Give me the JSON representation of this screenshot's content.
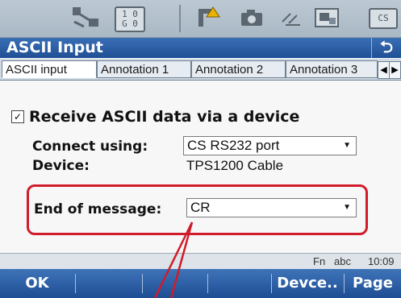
{
  "statusbar": {
    "icons": [
      "satellite-icon",
      "radio-icon",
      "level-icon",
      "camera-icon",
      "pen-icon",
      "image-icon",
      "memory-icon"
    ],
    "radio_top": "1 0",
    "radio_bottom": "G 0",
    "memory_label": "CS"
  },
  "title": "ASCII Input",
  "tabs": [
    "ASCII input",
    "Annotation 1",
    "Annotation 2",
    "Annotation 3"
  ],
  "receive_label": "Receive ASCII data via a device",
  "connect": {
    "label": "Connect using:",
    "value": "CS RS232 port"
  },
  "device": {
    "label": "Device:",
    "value": "TPS1200 Cable"
  },
  "end_of_message": {
    "label": "End of message:",
    "value": "CR"
  },
  "info": {
    "fn": "Fn",
    "mode": "abc",
    "time": "10:09"
  },
  "softkeys": {
    "f1": "OK",
    "f5": "Devce..",
    "f6": "Page"
  },
  "colors": {
    "accent": "#1f4f95",
    "highlight": "#d01c2a"
  }
}
